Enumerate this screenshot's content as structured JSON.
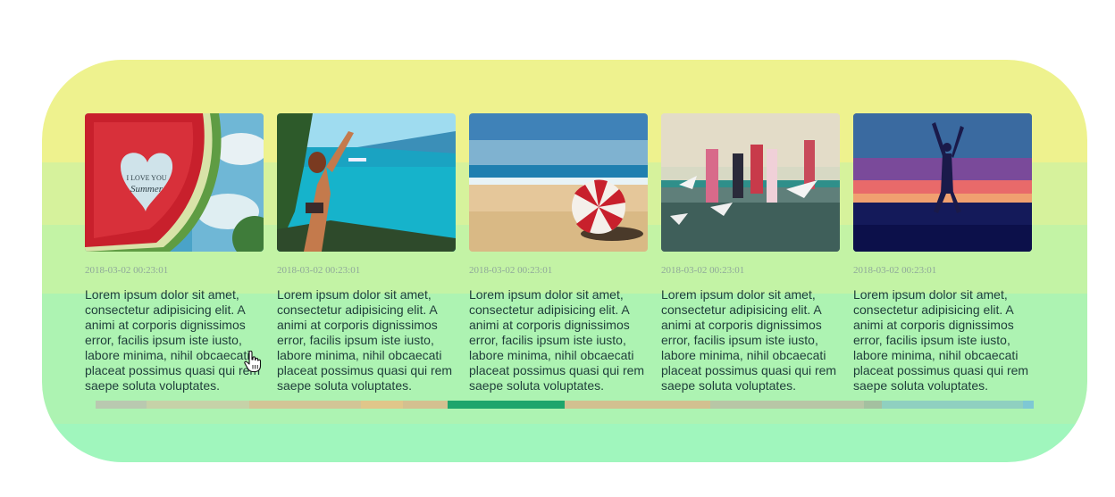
{
  "cards": [
    {
      "date": "2018-03-02 00:23:01",
      "text": "Lorem ipsum dolor sit amet, consectetur adipisicing elit. A animi at corporis dignissimos error, facilis ipsum iste iusto, labore minima, nihil obcaecati placeat possimus quasi qui rem saepe soluta voluptates.",
      "image": "watermelon-love-summer-image"
    },
    {
      "date": "2018-03-02 00:23:01",
      "text": "Lorem ipsum dolor sit amet, consectetur adipisicing elit. A animi at corporis dignissimos error, facilis ipsum iste iusto, labore minima, nihil obcaecati placeat possimus quasi qui rem saepe soluta voluptates.",
      "image": "girl-jumping-sea-image"
    },
    {
      "date": "2018-03-02 00:23:01",
      "text": "Lorem ipsum dolor sit amet, consectetur adipisicing elit. A animi at corporis dignissimos error, facilis ipsum iste iusto, labore minima, nihil obcaecati placeat possimus quasi qui rem saepe soluta voluptates.",
      "image": "beach-umbrella-image"
    },
    {
      "date": "2018-03-02 00:23:01",
      "text": "Lorem ipsum dolor sit amet, consectetur adipisicing elit. A animi at corporis dignissimos error, facilis ipsum iste iusto, labore minima, nihil obcaecati placeat possimus quasi qui rem saepe soluta voluptates.",
      "image": "people-seagulls-pier-image"
    },
    {
      "date": "2018-03-02 00:23:01",
      "text": "Lorem ipsum dolor sit amet, consectetur adipisicing elit. A animi at corporis dignissimos error, facilis ipsum iste iusto, labore minima, nihil obcaecati placeat possimus quasi qui rem saepe soluta voluptates.",
      "image": "silhouette-jump-sunset-image"
    }
  ],
  "watermark_text": [
    "I LOVE YOU",
    "Summer"
  ],
  "colors": {
    "accent": "#1ea56c",
    "panel_top": "#eef28e",
    "panel_bottom": "#a0f6bd",
    "text": "#1f3d3a",
    "date": "#8fa89a"
  },
  "scroll_position": 0.39
}
